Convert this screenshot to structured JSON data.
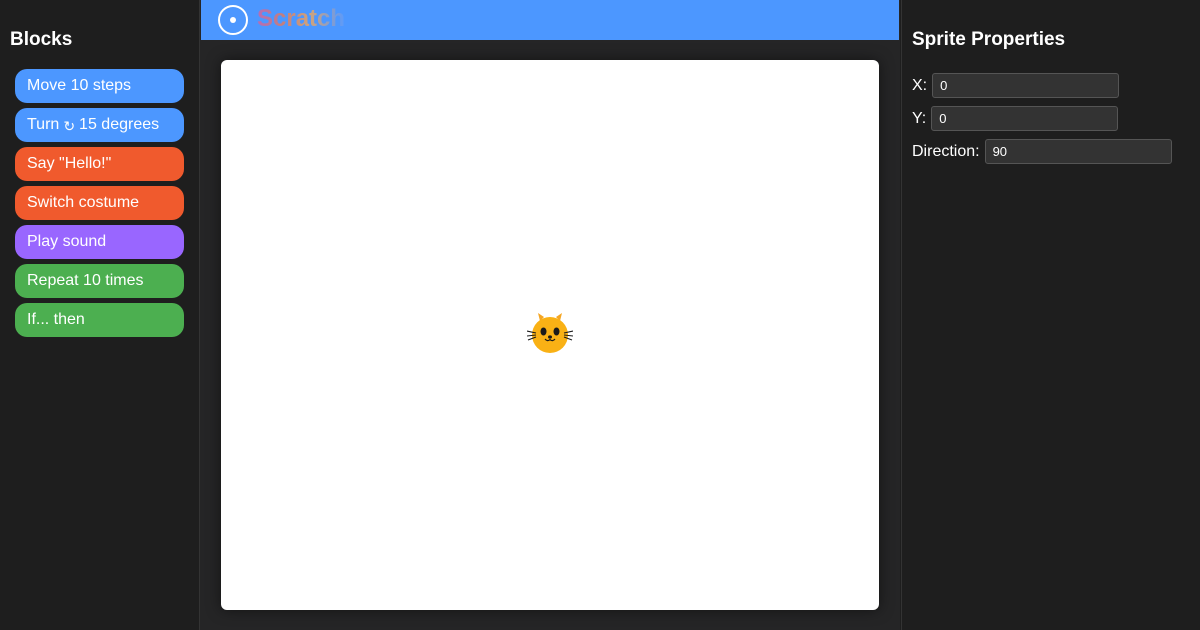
{
  "blocks_panel": {
    "title": "Blocks",
    "items": [
      {
        "label": "Move 10 steps",
        "color": "#4c97ff"
      },
      {
        "label_prefix": "Turn",
        "glyph": "↻",
        "label_suffix": "15 degrees",
        "color": "#4c97ff"
      },
      {
        "label": "Say \"Hello!\"",
        "color": "#f05a2d"
      },
      {
        "label": "Switch costume",
        "color": "#f05a2d"
      },
      {
        "label": "Play sound",
        "color": "#9966ff"
      },
      {
        "label": "Repeat 10 times",
        "color": "#4caf50"
      },
      {
        "label": "If... then",
        "color": "#4caf50"
      }
    ]
  },
  "header": {
    "app_name": "Scratch",
    "logo_icon": "circle-dot-icon",
    "color": "#4c97ff"
  },
  "stage": {
    "sprite_icon": "cat-face-icon"
  },
  "properties": {
    "title": "Sprite Properties",
    "x_label": "X:",
    "x_value": "0",
    "y_label": "Y:",
    "y_value": "0",
    "direction_label": "Direction:",
    "direction_value": "90"
  }
}
